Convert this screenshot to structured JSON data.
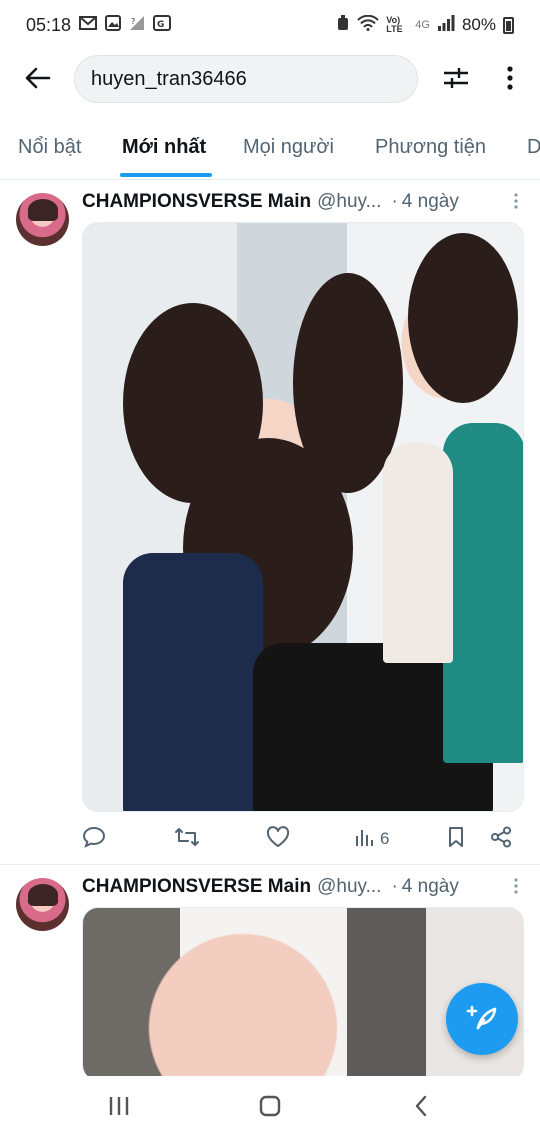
{
  "status_bar": {
    "time": "05:18",
    "network_label": "Vo) LTE",
    "network_type": "4G",
    "battery": "80%"
  },
  "search": {
    "query": "huyen_tran36466"
  },
  "tabs": [
    {
      "label": "Nổi bật"
    },
    {
      "label": "Mới nhất"
    },
    {
      "label": "Mọi người"
    },
    {
      "label": "Phương tiện"
    },
    {
      "label": "D"
    }
  ],
  "tweets": [
    {
      "display_name": "CHAMPIONSVERSE Main",
      "handle": "@huy...",
      "time": "4 ngày",
      "views": "6"
    },
    {
      "display_name": "CHAMPIONSVERSE Main",
      "handle": "@huy...",
      "time": "4 ngày"
    }
  ],
  "colors": {
    "accent": "#1d9bf0",
    "text_primary": "#0f1419",
    "text_secondary": "#536471"
  },
  "icons": {
    "back": "arrow-left-icon",
    "filter": "sliders-icon",
    "more": "kebab-icon",
    "reply": "reply-icon",
    "retweet": "retweet-icon",
    "like": "heart-icon",
    "views": "chart-icon",
    "bookmark": "bookmark-icon",
    "share": "share-icon",
    "compose": "compose-icon"
  }
}
